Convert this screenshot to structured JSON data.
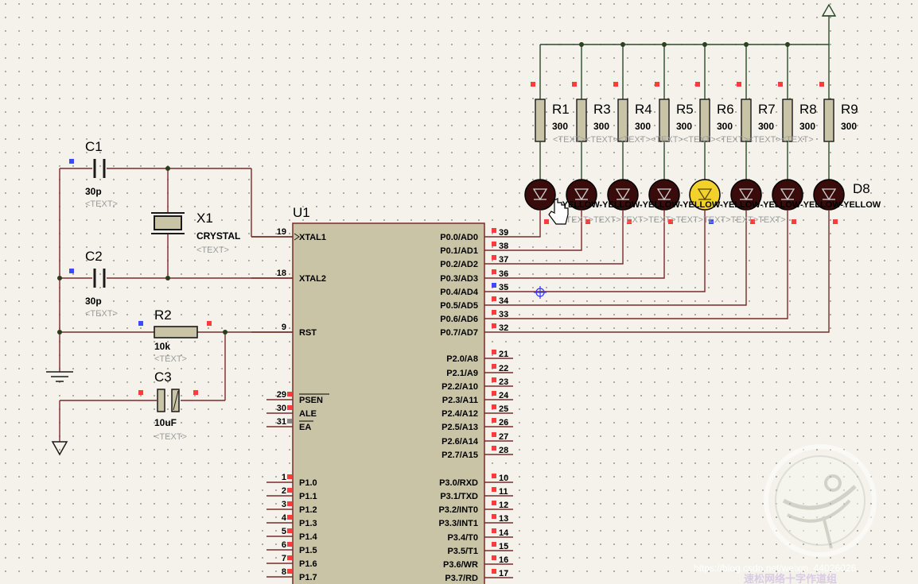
{
  "colors": {
    "background": "#f4f2ea",
    "wire": "#7a2a2a",
    "wire_dark": "#2a4a2a",
    "chip_fill": "#c9c4a6",
    "led_off": "#3a0b0b",
    "led_on": "#f2d22a",
    "pin_marker_red": "#ff3a3a",
    "pin_marker_blue": "#3a4aff"
  },
  "components": {
    "c1": {
      "ref": "C1",
      "value": "30p",
      "text": "<TEXT>"
    },
    "c2": {
      "ref": "C2",
      "value": "30p",
      "text": "<TEXT>"
    },
    "c3": {
      "ref": "C3",
      "value": "10uF",
      "text": "<TEXT>"
    },
    "x1": {
      "ref": "X1",
      "value": "CRYSTAL",
      "text": "<TEXT>"
    },
    "r2": {
      "ref": "R2",
      "value": "10k",
      "text": "<TEXT>"
    },
    "u1": {
      "ref": "U1"
    }
  },
  "resistors": [
    {
      "ref": "R1",
      "value": "300"
    },
    {
      "ref": "R3",
      "value": "300"
    },
    {
      "ref": "R4",
      "value": "300"
    },
    {
      "ref": "R5",
      "value": "300"
    },
    {
      "ref": "R6",
      "value": "300"
    },
    {
      "ref": "R7",
      "value": "300"
    },
    {
      "ref": "R8",
      "value": "300"
    },
    {
      "ref": "R9",
      "value": "300"
    }
  ],
  "resistor_text_row": "<TEXT><TEXT><TEXT><TEXT><TEXT><TEXT><TEXT><TEXT>",
  "led_last_ref": "D8",
  "led_label_row": "<TEXT>TEXT>TEXT>TEXT>TEXT>TEXT>TEXT>TEXT>",
  "led_type_row": "-YELLOW-YELLOW-YELLOW-YELLOW-YELLOW-YELLOW-YELLOW-YELLOW",
  "leds": [
    {
      "state": "off"
    },
    {
      "state": "off"
    },
    {
      "state": "off"
    },
    {
      "state": "off"
    },
    {
      "state": "on"
    },
    {
      "state": "off"
    },
    {
      "state": "off"
    },
    {
      "state": "off"
    }
  ],
  "u1_left_pins": [
    {
      "num": "19",
      "name": "XTAL1"
    },
    {
      "num": "18",
      "name": "XTAL2"
    },
    {
      "num": "9",
      "name": "RST"
    },
    {
      "num": "29",
      "name": "PSEN"
    },
    {
      "num": "30",
      "name": "ALE"
    },
    {
      "num": "31",
      "name": "EA"
    },
    {
      "num": "1",
      "name": "P1.0"
    },
    {
      "num": "2",
      "name": "P1.1"
    },
    {
      "num": "3",
      "name": "P1.2"
    },
    {
      "num": "4",
      "name": "P1.3"
    },
    {
      "num": "5",
      "name": "P1.4"
    },
    {
      "num": "6",
      "name": "P1.5"
    },
    {
      "num": "7",
      "name": "P1.6"
    },
    {
      "num": "8",
      "name": "P1.7"
    }
  ],
  "u1_right_pins": [
    {
      "num": "39",
      "name": "P0.0/AD0"
    },
    {
      "num": "38",
      "name": "P0.1/AD1"
    },
    {
      "num": "37",
      "name": "P0.2/AD2"
    },
    {
      "num": "36",
      "name": "P0.3/AD3"
    },
    {
      "num": "35",
      "name": "P0.4/AD4"
    },
    {
      "num": "34",
      "name": "P0.5/AD5"
    },
    {
      "num": "33",
      "name": "P0.6/AD6"
    },
    {
      "num": "32",
      "name": "P0.7/AD7"
    },
    {
      "num": "21",
      "name": "P2.0/A8"
    },
    {
      "num": "22",
      "name": "P2.1/A9"
    },
    {
      "num": "23",
      "name": "P2.2/A10"
    },
    {
      "num": "24",
      "name": "P2.3/A11"
    },
    {
      "num": "25",
      "name": "P2.4/A12"
    },
    {
      "num": "26",
      "name": "P2.5/A13"
    },
    {
      "num": "27",
      "name": "P2.6/A14"
    },
    {
      "num": "28",
      "name": "P2.7/A15"
    },
    {
      "num": "10",
      "name": "P3.0/RXD"
    },
    {
      "num": "11",
      "name": "P3.1/TXD"
    },
    {
      "num": "12",
      "name": "P3.2/INT0"
    },
    {
      "num": "13",
      "name": "P3.3/INT1"
    },
    {
      "num": "14",
      "name": "P3.4/T0"
    },
    {
      "num": "15",
      "name": "P3.5/T1"
    },
    {
      "num": "16",
      "name": "P3.6/WR"
    },
    {
      "num": "17",
      "name": "P3.7/RD"
    }
  ],
  "watermark": {
    "url": "https://blog.csdn.net/weixin_44026026",
    "cn_text": "速松网络十字作道组"
  }
}
